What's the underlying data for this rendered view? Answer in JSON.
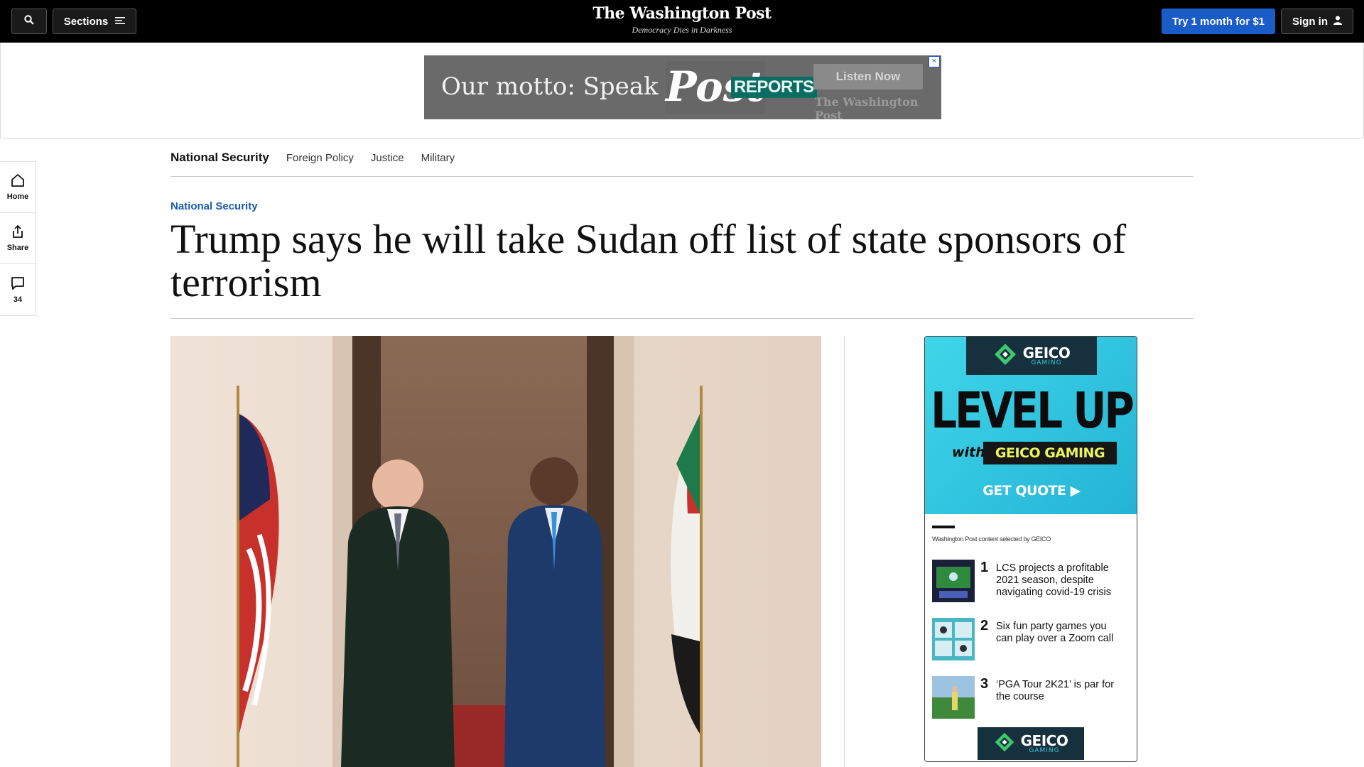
{
  "header": {
    "sections_label": "Sections",
    "masthead_name": "The Washington Post",
    "masthead_motto": "Democracy Dies in Darkness",
    "try_label": "Try 1 month for $1",
    "signin_label": "Sign in"
  },
  "top_ad": {
    "motto_text": "Our motto: Speak so",
    "logo_text": "Post",
    "reports_text": "REPORTS",
    "listen_label": "Listen Now",
    "brand_text": "The Washington Post",
    "close_label": "×"
  },
  "left_rail": {
    "home_label": "Home",
    "share_label": "Share",
    "comments_count": "34"
  },
  "section_nav": {
    "title": "National Security",
    "links": [
      "Foreign Policy",
      "Justice",
      "Military"
    ]
  },
  "article": {
    "kicker": "National Security",
    "headline": "Trump says he will take Sudan off list of state sponsors of terrorism"
  },
  "right_ad": {
    "geico_brand": "GEICO",
    "geico_sub": "GAMING",
    "level_up": "LEVEL UP",
    "with": "with",
    "geico_gaming": "GEICO GAMING",
    "get_quote": "GET QUOTE ▶",
    "selected_by": "Washington Post content selected by GEICO",
    "items": [
      {
        "num": "1",
        "text": "LCS projects a profitable 2021 season, despite navigating covid-19 crisis"
      },
      {
        "num": "2",
        "text": "Six fun party games you can play over a Zoom call"
      },
      {
        "num": "3",
        "text": "‘PGA Tour 2K21’ is par for the course"
      }
    ]
  },
  "colors": {
    "accent_blue": "#1a5cc8",
    "kicker_blue": "#1a5ca8",
    "geico_navy": "#16313d",
    "geico_cyan": "#3fd6e9",
    "geico_yellow": "#e9f65b"
  },
  "icons": [
    "search-icon",
    "menu-icon",
    "user-icon",
    "home-icon",
    "share-icon",
    "comment-icon",
    "close-icon",
    "geico-logo-icon"
  ]
}
